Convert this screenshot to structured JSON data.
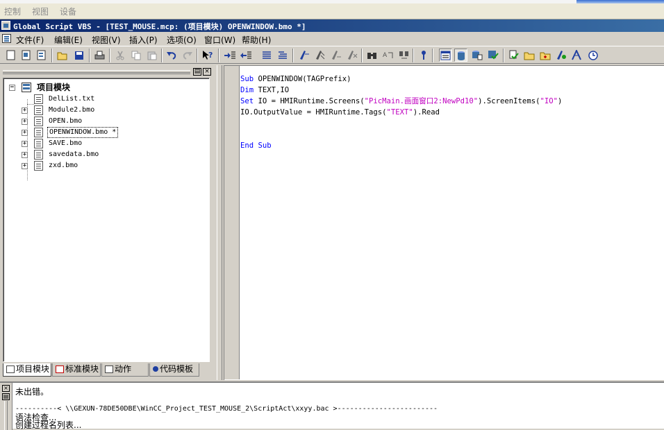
{
  "top_menu": [
    "控制",
    "视图",
    "设备"
  ],
  "window": {
    "title": "Global Script VBS - [TEST_MOUSE.mcp: (项目模块) OPENWINDOW.bmo *]"
  },
  "menu": [
    "文件(F)",
    "编辑(E)",
    "视图(V)",
    "插入(P)",
    "选项(O)",
    "窗口(W)",
    "帮助(H)"
  ],
  "toolbar": {
    "buttons": [
      "new-file",
      "new-module",
      "new-action",
      "open",
      "save",
      "print",
      "cut",
      "copy",
      "paste",
      "undo",
      "redo",
      "context-help",
      "indent",
      "outdent",
      "comment",
      "uncomment",
      "bookmark",
      "next-bookmark",
      "prev-bookmark",
      "clear-bookmarks",
      "find",
      "replace",
      "find-next",
      "info",
      "view-1",
      "view-2",
      "view-3",
      "view-4",
      "check-syntax",
      "folder",
      "new-folder",
      "edit-action",
      "tag",
      "trigger"
    ]
  },
  "tree": {
    "root": "项目模块",
    "items": [
      {
        "name": "DelList.txt",
        "expandable": false,
        "selected": false
      },
      {
        "name": "Module2.bmo",
        "expandable": true,
        "selected": false
      },
      {
        "name": "OPEN.bmo",
        "expandable": true,
        "selected": false
      },
      {
        "name": "OPENWINDOW.bmo *",
        "expandable": true,
        "selected": true
      },
      {
        "name": "SAVE.bmo",
        "expandable": true,
        "selected": false
      },
      {
        "name": "savedata.bmo",
        "expandable": true,
        "selected": false
      },
      {
        "name": "zxd.bmo",
        "expandable": true,
        "selected": false
      }
    ]
  },
  "tabs": [
    "项目模块",
    "标准模块",
    "动作",
    "代码模板"
  ],
  "code": {
    "l1_kw": "Sub",
    "l1_rest": " OPENWINDOW(TAGPrefix)",
    "l2_kw": "Dim",
    "l2_rest": " TEXT,IO",
    "l3_kw": "Set",
    "l3_a": " IO = HMIRuntime.Screens(",
    "l3_s1": "\"PicMain.画面窗口2:NewPd10\"",
    "l3_b": ").ScreenItems(",
    "l3_s2": "\"IO\"",
    "l3_c": ")",
    "l4_a": "IO.OutputValue = HMIRuntime.Tags(",
    "l4_s1": "\"TEXT\"",
    "l4_b": ").Read",
    "l7_kw": "End Sub"
  },
  "output": {
    "line1": "未出错。",
    "line2": "----------< \\\\GEXUN-78DE50DBE\\WinCC_Project_TEST_MOUSE_2\\ScriptAct\\xxyy.bac >------------------------",
    "line3": "语法检查...",
    "line4": "创建过程名列表..."
  },
  "colors": {
    "keyword": "#0000ff",
    "string": "#c000c0",
    "title_from": "#0a246a",
    "title_to": "#3a6ea5"
  }
}
